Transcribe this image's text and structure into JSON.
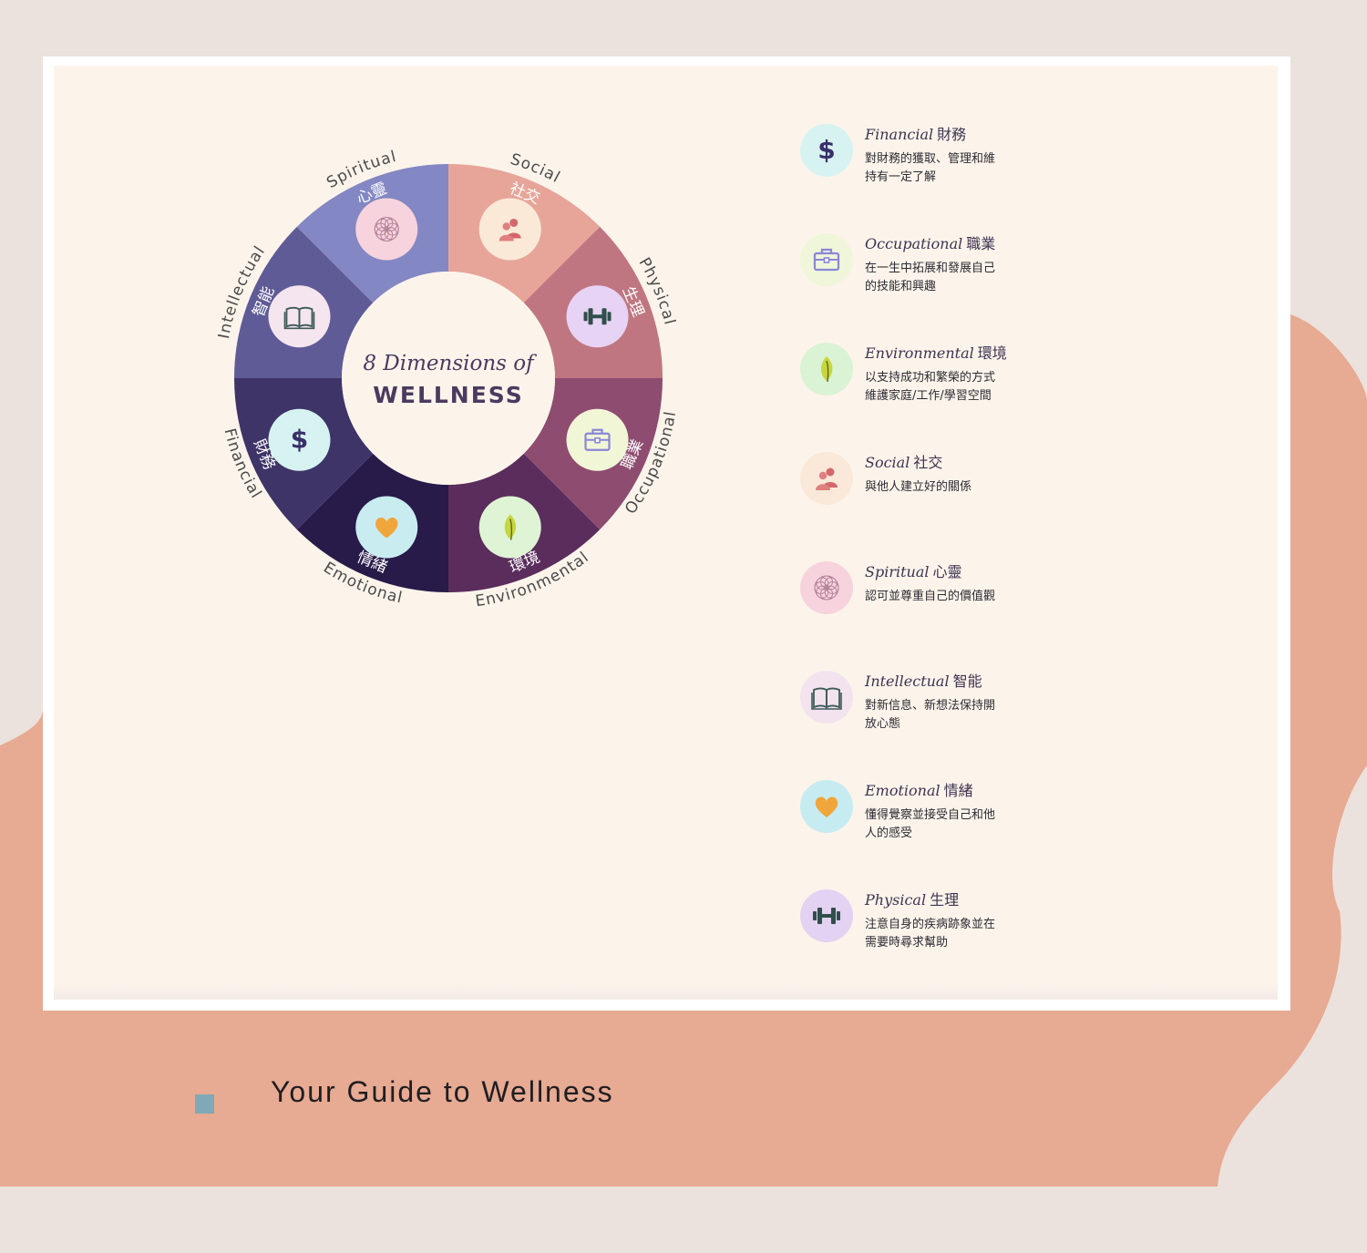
{
  "wheel": {
    "center": {
      "line1": "8 Dimensions of",
      "line2": "WELLNESS"
    },
    "segments": [
      {
        "key": "social",
        "en": "Social",
        "zh": "社交",
        "color": "#e7a599",
        "icon": "people-icon",
        "icon_bg": "#fbe9d8"
      },
      {
        "key": "physical",
        "en": "Physical",
        "zh": "生理",
        "color": "#bf7681",
        "icon": "dumbbell-icon",
        "icon_bg": "#e7d3f3"
      },
      {
        "key": "occupational",
        "en": "Occupational",
        "zh": "職業",
        "color": "#8e4c70",
        "icon": "briefcase-icon",
        "icon_bg": "#f1f6d6"
      },
      {
        "key": "environmental",
        "en": "Environmental",
        "zh": "環境",
        "color": "#5a2d5c",
        "icon": "leaf-icon",
        "icon_bg": "#dff4d4"
      },
      {
        "key": "emotional",
        "en": "Emotional",
        "zh": "情緒",
        "color": "#281a49",
        "icon": "heart-icon",
        "icon_bg": "#c9ecf1"
      },
      {
        "key": "financial",
        "en": "Financial",
        "zh": "財務",
        "color": "#3e3468",
        "icon": "dollar-icon",
        "icon_bg": "#d7f3f1"
      },
      {
        "key": "intellectual",
        "en": "Intellectual",
        "zh": "智能",
        "color": "#5f5b96",
        "icon": "book-icon",
        "icon_bg": "#f4e5ef"
      },
      {
        "key": "spiritual",
        "en": "Spiritual",
        "zh": "心靈",
        "color": "#8387c3",
        "icon": "mandala-icon",
        "icon_bg": "#f6d3dd"
      }
    ]
  },
  "legend": [
    {
      "key": "financial",
      "title": "Financial",
      "zh": "財務",
      "desc": "對財務的獲取、管理和維持有一定了解",
      "icon": "dollar-icon",
      "bg": "#d7f3f1"
    },
    {
      "key": "occupational",
      "title": "Occupational",
      "zh": "職業",
      "desc": "在一生中拓展和發展自己的技能和興趣",
      "icon": "briefcase-icon",
      "bg": "#eff6d9"
    },
    {
      "key": "environmental",
      "title": "Environmental",
      "zh": "環境",
      "desc": "以支持成功和繁榮的方式維護家庭/工作/學習空間",
      "icon": "leaf-icon",
      "bg": "#d9f3d4"
    },
    {
      "key": "social",
      "title": "Social",
      "zh": "社交",
      "desc": "與他人建立好的關係",
      "icon": "people-icon",
      "bg": "#fae8d8"
    },
    {
      "key": "spiritual",
      "title": "Spiritual",
      "zh": "心靈",
      "desc": "認可並尊重自己的價值觀",
      "icon": "mandala-icon",
      "bg": "#f6d3dd"
    },
    {
      "key": "intellectual",
      "title": "Intellectual",
      "zh": "智能",
      "desc": "對新信息、新想法保持開放心態",
      "icon": "book-icon",
      "bg": "#f2e3ee"
    },
    {
      "key": "emotional",
      "title": "Emotional",
      "zh": "情緒",
      "desc": "懂得覺察並接受自己和他人的感受",
      "icon": "heart-icon",
      "bg": "#c6ecf1"
    },
    {
      "key": "physical",
      "title": "Physical",
      "zh": "生理",
      "desc": "注意自身的疾病跡象並在需要時尋求幫助",
      "icon": "dumbbell-icon",
      "bg": "#e3d2f2"
    }
  ],
  "footer": {
    "text": "Your Guide to Wellness"
  },
  "colors": {
    "page_bg": "#ebe2dd",
    "blob": "#e7aa92",
    "panel": "#fcf4eb",
    "center_text": "#4b3a5f",
    "footer_mark": "#7fa9b7"
  }
}
